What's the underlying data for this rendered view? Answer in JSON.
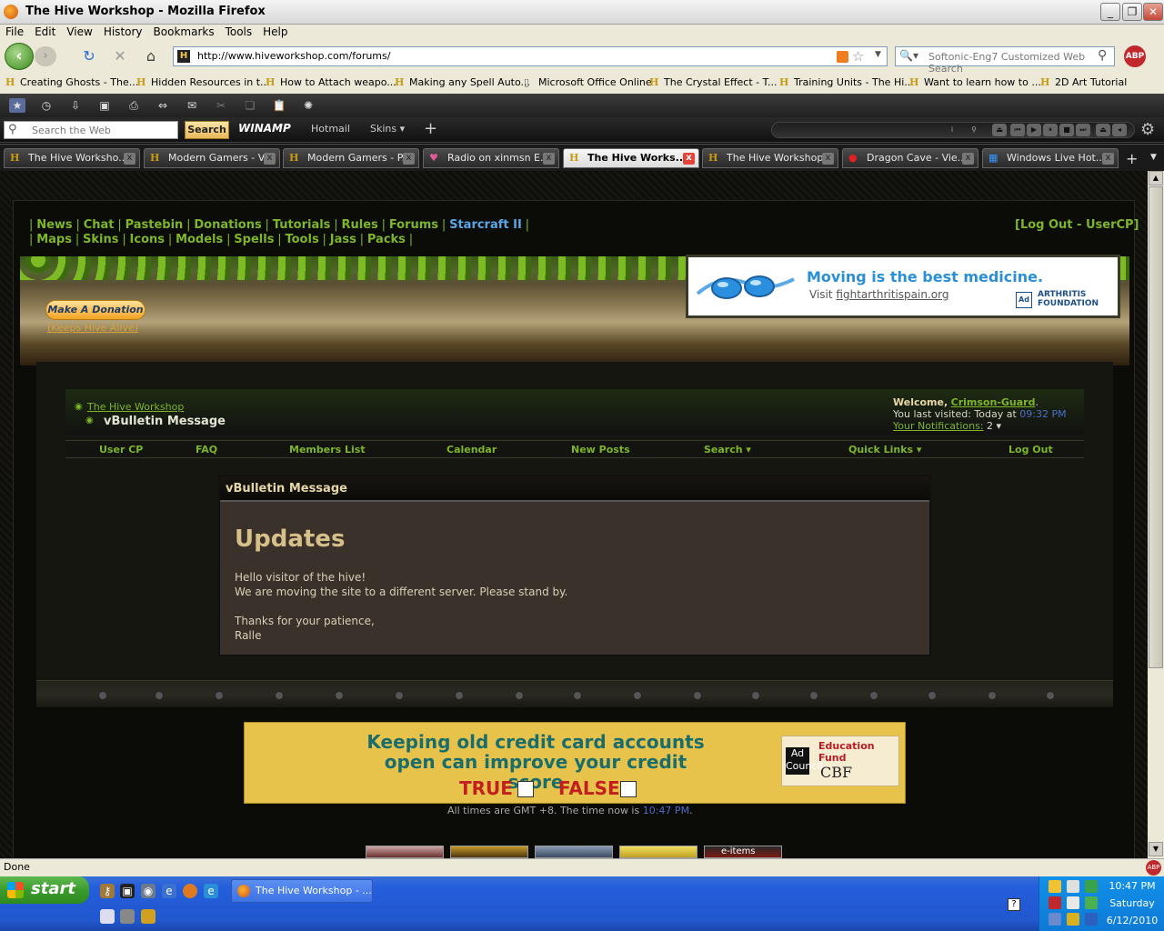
{
  "window": {
    "title": "The Hive Workshop - Mozilla Firefox"
  },
  "menu": [
    "File",
    "Edit",
    "View",
    "History",
    "Bookmarks",
    "Tools",
    "Help"
  ],
  "address": {
    "url": "http://www.hiveworkshop.com/forums/"
  },
  "search": {
    "placeholder": "Softonic-Eng7 Customized Web Search"
  },
  "bookmarks": [
    "Creating Ghosts - The...",
    "Hidden Resources in t...",
    "How to Attach weapo...",
    "Making any Spell Auto...",
    "Microsoft Office Online",
    "The Crystal Effect - T...",
    "Training Units - The Hi...",
    "Want to learn how to ...",
    "2D Art Tutorial"
  ],
  "winamp_bar": {
    "search_placeholder": "Search the Web",
    "search_button": "Search",
    "winamp": "WINAMP",
    "hotmail": "Hotmail",
    "skins": "Skins"
  },
  "tabs": [
    "The Hive Worksho...",
    "Modern Gamers - V...",
    "Modern Gamers - P...",
    "Radio on xinmsn E...",
    "The Hive Works...",
    "The Hive Workshop",
    "Dragon Cave - Vie...",
    "Windows Live Hot..."
  ],
  "site": {
    "toplinks_row1": [
      "News",
      "Chat",
      "Pastebin",
      "Donations",
      "Tutorials",
      "Rules",
      "Forums"
    ],
    "starcraft": "Starcraft II",
    "toplinks_row2": [
      "Maps",
      "Skins",
      "Icons",
      "Models",
      "Spells",
      "Tools",
      "Jass",
      "Packs"
    ],
    "logout_usercp": "[Log Out - UserCP]",
    "donate_button": "Make A Donation",
    "keep_alive": "(Keeps Hive Alive)",
    "ad1": {
      "headline": "Moving is the best medicine.",
      "visit": "Visit",
      "link": "fightarthritispain.org",
      "org": "ARTHRITIS FOUNDATION",
      "adcouncil": "Ad"
    },
    "breadcrumb": {
      "home": "The Hive Workshop",
      "current": "vBulletin Message"
    },
    "welcome": {
      "label": "Welcome,",
      "user": "Crimson-Guard",
      "last_visit_label": "You last visited: Today at",
      "last_visit_time": "09:32 PM",
      "notifications_label": "Your Notifications:",
      "notifications_count": "2"
    },
    "nav": [
      "User CP",
      "FAQ",
      "Members List",
      "Calendar",
      "New Posts",
      "Search",
      "Quick Links",
      "Log Out"
    ],
    "message": {
      "header": "vBulletin Message",
      "title": "Updates",
      "lines": [
        "Hello visitor of the hive!",
        "We are moving the site to a different server. Please stand by.",
        "",
        "Thanks for your patience,",
        "Ralle"
      ]
    },
    "ad2": {
      "question": "Keeping old credit card accounts open can improve your credit score",
      "true": "TRUE",
      "false": "FALSE",
      "org": "Education Fund",
      "cbf": "CBF",
      "adcouncil": "Ad Council"
    },
    "time_note": "All times are GMT +8. The time now is",
    "time_now": "10:47 PM",
    "e_items": "e-items"
  },
  "status": {
    "text": "Done"
  },
  "taskbar": {
    "start": "start",
    "task": "The Hive Workshop - ...",
    "time": "10:47 PM",
    "day": "Saturday",
    "date": "6/12/2010"
  }
}
